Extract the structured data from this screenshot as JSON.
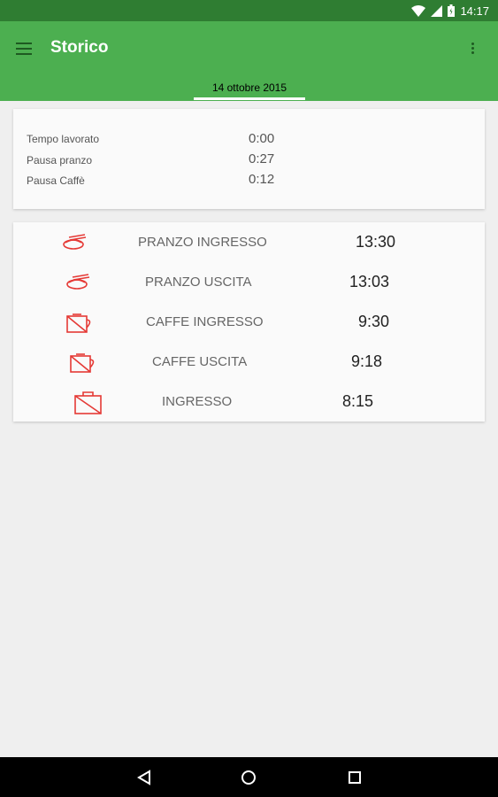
{
  "status_bar": {
    "time": "14:17"
  },
  "app_bar": {
    "title": "Storico"
  },
  "tab": {
    "label": "14 ottobre 2015"
  },
  "summary": [
    {
      "label": "Tempo lavorato",
      "value": "0:00"
    },
    {
      "label": "Pausa pranzo",
      "value": "0:27"
    },
    {
      "label": "Pausa Caffè",
      "value": "0:12"
    }
  ],
  "events": [
    {
      "label": "PRANZO INGRESSO",
      "time": "13:30",
      "icon": "lunch-icon"
    },
    {
      "label": "PRANZO USCITA",
      "time": "13:03",
      "icon": "lunch-icon"
    },
    {
      "label": "CAFFE INGRESSO",
      "time": "9:30",
      "icon": "coffee-cup-icon"
    },
    {
      "label": "CAFFE USCITA",
      "time": "9:18",
      "icon": "coffee-cup-icon"
    },
    {
      "label": "INGRESSO",
      "time": "8:15",
      "icon": "briefcase-icon"
    }
  ],
  "colors": {
    "primary": "#4caf50",
    "status_bar": "#2f7d32",
    "icon_red": "#e53935"
  }
}
